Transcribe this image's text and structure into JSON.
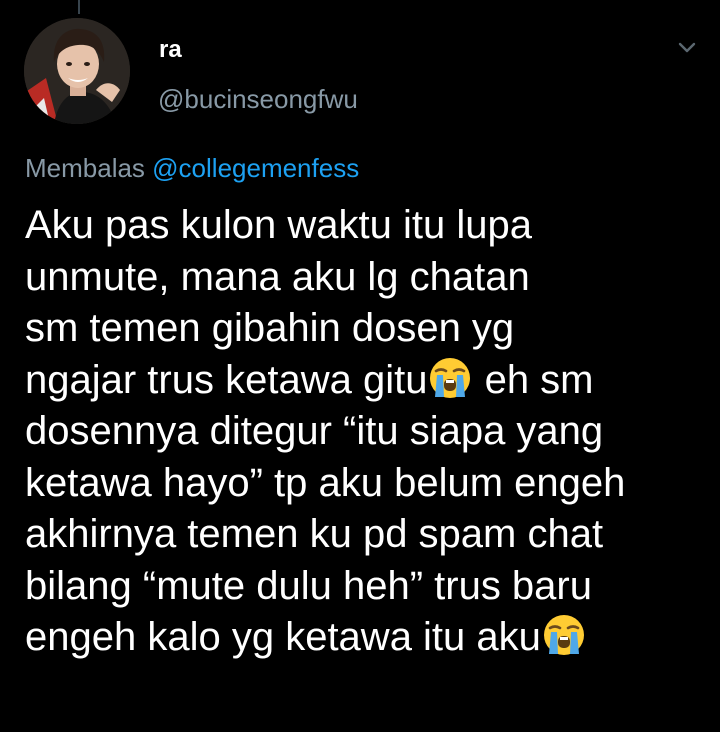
{
  "author": {
    "display_name": "ra",
    "handle": "@bucinseongfwu"
  },
  "reply": {
    "prefix": "Membalas ",
    "mention": "@collegemenfess"
  },
  "tweet": {
    "lines": [
      {
        "text": "Aku pas kulon waktu itu lupa",
        "emoji": "",
        "after": ""
      },
      {
        "text": "unmute, mana aku lg chatan",
        "emoji": "",
        "after": ""
      },
      {
        "text": "sm temen gibahin dosen yg",
        "emoji": "",
        "after": ""
      },
      {
        "text": "ngajar trus ketawa gitu",
        "emoji": "loudly-crying-face",
        "after": " eh sm"
      },
      {
        "text": "dosennya ditegur “itu siapa yang",
        "emoji": "",
        "after": ""
      },
      {
        "text": "ketawa hayo” tp aku belum engeh",
        "emoji": "",
        "after": ""
      },
      {
        "text": "akhirnya temen ku pd spam chat",
        "emoji": "",
        "after": ""
      },
      {
        "text": "bilang “mute dulu heh” trus baru",
        "emoji": "",
        "after": ""
      },
      {
        "text": "engeh kalo yg ketawa itu aku",
        "emoji": "loudly-crying-face",
        "after": ""
      }
    ]
  },
  "icons": {
    "menu": "chevron-down-icon",
    "emoji": "loudly-crying-face-emoji"
  },
  "colors": {
    "background": "#000000",
    "text": "#ffffff",
    "secondary_text": "#8899a6",
    "link": "#1da1f2"
  }
}
